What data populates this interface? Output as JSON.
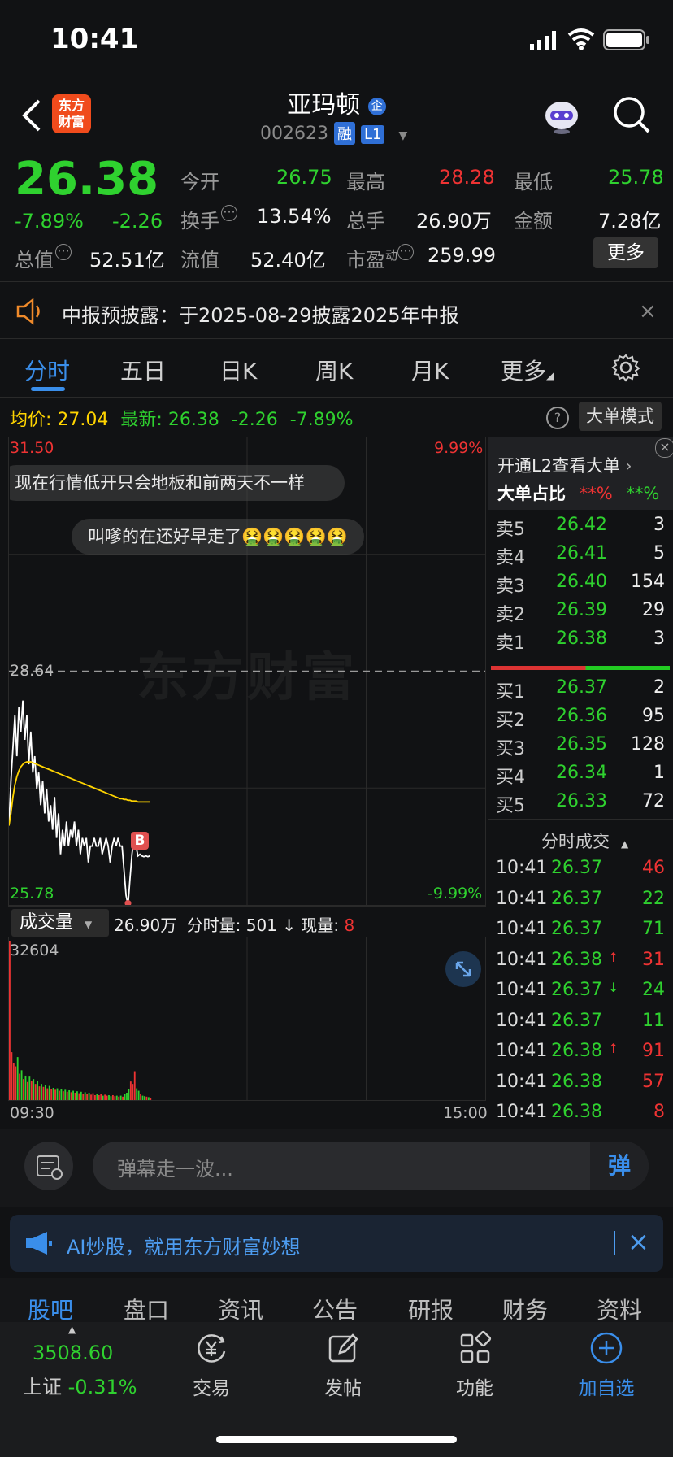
{
  "status": {
    "time": "10:41"
  },
  "header": {
    "logo_text": "东方\n财富",
    "stock_name": "亚玛顿",
    "stock_code": "002623",
    "tag_rong": "融",
    "tag_l1": "L1",
    "badge": "企"
  },
  "quote": {
    "price": "26.38",
    "change_pct": "-7.89%",
    "change": "-2.26",
    "fields": [
      {
        "label": "今开",
        "value": "26.75"
      },
      {
        "label": "最高",
        "value": "28.28"
      },
      {
        "label": "最低",
        "value": "25.78"
      },
      {
        "label": "换手",
        "value": "13.54%"
      },
      {
        "label": "总手",
        "value": "26.90万"
      },
      {
        "label": "金额",
        "value": "7.28亿"
      },
      {
        "label": "总值",
        "value": "52.51亿"
      },
      {
        "label": "流值",
        "value": "52.40亿"
      },
      {
        "label": "市盈",
        "label_sup": "动",
        "value": "259.99"
      }
    ],
    "more_button": "更多"
  },
  "banner": {
    "text": "中报预披露：于2025-08-29披露2025年中报"
  },
  "tabs": [
    "分时",
    "五日",
    "日K",
    "周K",
    "月K",
    "更多"
  ],
  "chart_info": {
    "avg_label": "均价:",
    "avg_value": "27.04",
    "latest_label": "最新:",
    "latest_value": "26.38",
    "latest_change": "-2.26",
    "latest_pct": "-7.89%",
    "mode_button": "大单模式"
  },
  "chart_labels": {
    "top_price": "31.50",
    "top_pct": "9.99%",
    "mid_price": "28.64",
    "bottom_price": "25.78",
    "bottom_pct": "-9.99%",
    "watermark": "东方财富",
    "b_marker": "B"
  },
  "danmu": [
    "现在行情低开只会地板和前两天不一样",
    "叫嗲的在还好早走了🤮🤮🤮🤮🤮"
  ],
  "volume": {
    "selector": "成交量",
    "total": "26.90万",
    "minute_label": "分时量:",
    "minute_value": "501",
    "now_label": "现量:",
    "now_value": "8",
    "max": "32604",
    "time_start": "09:30",
    "time_end": "15:00"
  },
  "chart_data": {
    "type": "line",
    "x": [
      "09:30",
      "09:31",
      "09:32",
      "09:33",
      "09:34",
      "09:35",
      "09:36",
      "09:37",
      "09:38",
      "09:39",
      "09:40",
      "09:41",
      "09:42",
      "09:43",
      "09:44",
      "09:45",
      "09:46",
      "09:47",
      "09:48",
      "09:49",
      "09:50",
      "09:51",
      "09:52",
      "09:53",
      "09:54",
      "09:55",
      "09:56",
      "09:57",
      "09:58",
      "09:59",
      "10:00",
      "10:01",
      "10:02",
      "10:03",
      "10:04",
      "10:05",
      "10:06",
      "10:07",
      "10:08",
      "10:09",
      "10:10",
      "10:11",
      "10:12",
      "10:13",
      "10:14",
      "10:15",
      "10:16",
      "10:17",
      "10:18",
      "10:19",
      "10:20",
      "10:21",
      "10:22",
      "10:23",
      "10:24",
      "10:25",
      "10:26",
      "10:27",
      "10:28",
      "10:29",
      "10:30",
      "10:31",
      "10:32",
      "10:33",
      "10:34",
      "10:35",
      "10:36",
      "10:37",
      "10:38",
      "10:39",
      "10:40",
      "10:41"
    ],
    "series": [
      {
        "values": [
          26.75,
          27.3,
          27.7,
          28.1,
          27.6,
          28.2,
          27.9,
          28.28,
          27.8,
          28.1,
          27.5,
          27.9,
          27.4,
          27.6,
          27.2,
          27.4,
          27.0,
          27.3,
          26.9,
          27.2,
          26.8,
          27.0,
          26.7,
          27.1,
          26.6,
          26.9,
          26.4,
          26.7,
          26.5,
          26.8,
          26.5,
          26.7,
          26.6,
          26.8,
          26.5,
          26.7,
          26.4,
          26.6,
          26.5,
          26.6,
          26.3,
          26.5,
          26.5,
          26.6,
          26.5,
          26.5,
          26.6,
          26.4,
          26.5,
          26.6,
          26.5,
          26.3,
          26.5,
          26.6,
          26.5,
          26.6,
          26.5,
          26.5,
          26.2,
          25.9,
          25.78,
          26.1,
          26.4,
          26.6,
          26.5,
          26.38,
          26.4,
          26.38,
          26.37,
          26.38,
          26.37,
          26.38
        ]
      },
      {
        "values": [
          26.75,
          26.9,
          27.1,
          27.25,
          27.35,
          27.42,
          27.47,
          27.5,
          27.52,
          27.53,
          27.53,
          27.53,
          27.52,
          27.51,
          27.5,
          27.49,
          27.48,
          27.47,
          27.46,
          27.45,
          27.44,
          27.43,
          27.42,
          27.41,
          27.4,
          27.39,
          27.38,
          27.37,
          27.36,
          27.35,
          27.34,
          27.33,
          27.32,
          27.31,
          27.3,
          27.29,
          27.28,
          27.27,
          27.26,
          27.25,
          27.24,
          27.23,
          27.22,
          27.21,
          27.2,
          27.19,
          27.18,
          27.17,
          27.16,
          27.15,
          27.14,
          27.13,
          27.12,
          27.11,
          27.1,
          27.09,
          27.08,
          27.08,
          27.07,
          27.07,
          27.06,
          27.06,
          27.05,
          27.05,
          27.05,
          27.04,
          27.04,
          27.04,
          27.04,
          27.04,
          27.04,
          27.04
        ]
      }
    ],
    "ylim": [
      25.78,
      31.5
    ],
    "reference": 28.64,
    "volume_ylim": [
      0,
      32604
    ]
  },
  "orderbook": {
    "l2_title": "开通L2查看大单",
    "big_ratio_label": "大单占比",
    "big_ratio_red": "**%",
    "big_ratio_green": "**%",
    "sells": [
      {
        "label": "卖5",
        "price": "26.42",
        "vol": "3"
      },
      {
        "label": "卖4",
        "price": "26.41",
        "vol": "5"
      },
      {
        "label": "卖3",
        "price": "26.40",
        "vol": "154"
      },
      {
        "label": "卖2",
        "price": "26.39",
        "vol": "29"
      },
      {
        "label": "卖1",
        "price": "26.38",
        "vol": "3"
      }
    ],
    "buys": [
      {
        "label": "买1",
        "price": "26.37",
        "vol": "2"
      },
      {
        "label": "买2",
        "price": "26.36",
        "vol": "95"
      },
      {
        "label": "买3",
        "price": "26.35",
        "vol": "128"
      },
      {
        "label": "买4",
        "price": "26.34",
        "vol": "1"
      },
      {
        "label": "买5",
        "price": "26.33",
        "vol": "72"
      }
    ],
    "trades_title": "分时成交",
    "trades": [
      {
        "time": "10:41",
        "price": "26.37",
        "arrow": "",
        "vol": "46",
        "color": "red"
      },
      {
        "time": "10:41",
        "price": "26.37",
        "arrow": "",
        "vol": "22",
        "color": "green"
      },
      {
        "time": "10:41",
        "price": "26.37",
        "arrow": "",
        "vol": "71",
        "color": "green"
      },
      {
        "time": "10:41",
        "price": "26.38",
        "arrow": "↑",
        "vol": "31",
        "color": "red"
      },
      {
        "time": "10:41",
        "price": "26.37",
        "arrow": "↓",
        "vol": "24",
        "color": "green"
      },
      {
        "time": "10:41",
        "price": "26.37",
        "arrow": "",
        "vol": "11",
        "color": "green"
      },
      {
        "time": "10:41",
        "price": "26.38",
        "arrow": "↑",
        "vol": "91",
        "color": "red"
      },
      {
        "time": "10:41",
        "price": "26.38",
        "arrow": "",
        "vol": "57",
        "color": "red"
      },
      {
        "time": "10:41",
        "price": "26.38",
        "arrow": "",
        "vol": "8",
        "color": "red"
      }
    ]
  },
  "comment": {
    "placeholder": "弹幕走一波...",
    "send": "弹"
  },
  "ai_banner": {
    "text": "AI炒股，就用东方财富妙想"
  },
  "subtabs": [
    "股吧",
    "盘口",
    "资讯",
    "公告",
    "研报",
    "财务",
    "资料"
  ],
  "bottom_nav": {
    "index_value": "3508.60",
    "index_name": "上证",
    "index_pct": "-0.31%",
    "items": [
      {
        "label": "交易",
        "icon": "yen-circle-icon"
      },
      {
        "label": "发帖",
        "icon": "edit-icon"
      },
      {
        "label": "功能",
        "icon": "grid-icon"
      },
      {
        "label": "加自选",
        "icon": "plus-circle-icon"
      }
    ]
  },
  "colors": {
    "up": "#ee3333",
    "down": "#2fd12f",
    "accent": "#3a8eea",
    "avg_line": "#ffd400"
  }
}
